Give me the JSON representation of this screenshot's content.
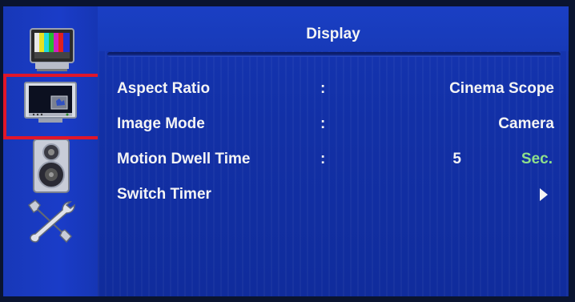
{
  "header": {
    "title": "Display"
  },
  "sidebar": {
    "items": [
      {
        "icon": "tv-test-pattern-icon",
        "selected": false
      },
      {
        "icon": "display-monitor-icon",
        "selected": true
      },
      {
        "icon": "speaker-icon",
        "selected": false
      },
      {
        "icon": "tools-icon",
        "selected": false
      }
    ],
    "highlight_color": "#e0162a"
  },
  "menu": {
    "separator": ":",
    "rows": [
      {
        "label": "Aspect Ratio",
        "value": "Cinema Scope"
      },
      {
        "label": "Image Mode",
        "value": "Camera"
      },
      {
        "label": "Motion Dwell Time",
        "value": "5",
        "unit": "Sec."
      },
      {
        "label": "Switch Timer",
        "submenu_icon": "right-arrow-icon"
      }
    ]
  },
  "colors": {
    "background": "#142a9a",
    "text": "#f4f4f4",
    "unit_text": "#8fe08a"
  }
}
